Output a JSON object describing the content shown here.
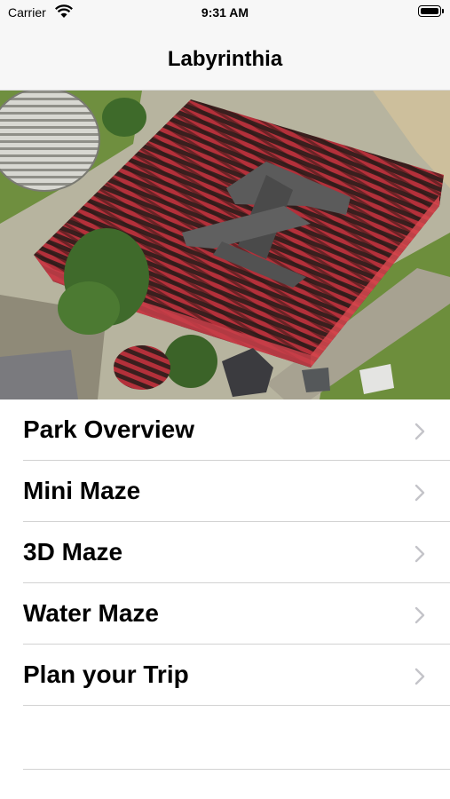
{
  "status_bar": {
    "carrier": "Carrier",
    "time": "9:31 AM",
    "wifi_icon": "wifi-icon",
    "battery_icon": "battery-icon"
  },
  "nav": {
    "title": "Labyrinthia"
  },
  "hero": {
    "image": "aerial-maze-photo",
    "description_icon": "maze-photo"
  },
  "menu": {
    "items": [
      {
        "label": "Park Overview",
        "icon": "chevron-right-icon"
      },
      {
        "label": "Mini Maze",
        "icon": "chevron-right-icon"
      },
      {
        "label": "3D Maze",
        "icon": "chevron-right-icon"
      },
      {
        "label": "Water Maze",
        "icon": "chevron-right-icon"
      },
      {
        "label": "Plan your Trip",
        "icon": "chevron-right-icon"
      }
    ]
  },
  "colors": {
    "chevron": "#c4c4c9",
    "separator": "#d2d2d2",
    "bar_background": "#f7f7f7",
    "maze_red": "#b3303a"
  }
}
